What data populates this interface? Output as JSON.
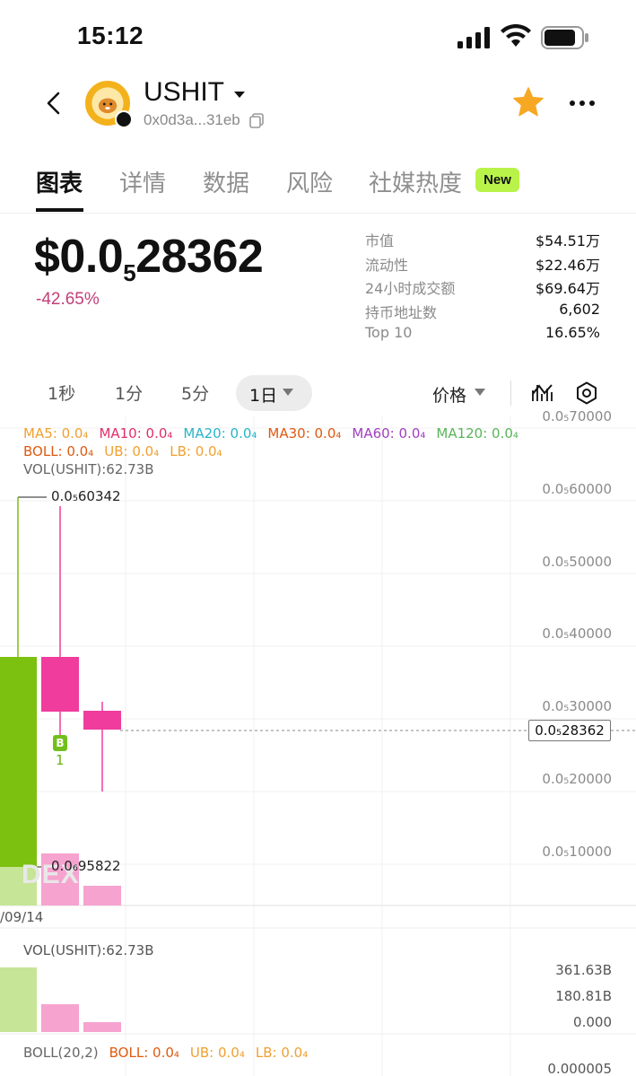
{
  "status_bar": {
    "time": "15:12"
  },
  "header": {
    "token_name": "USHIT",
    "token_address": "0x0d3a...31eb"
  },
  "tabs": [
    {
      "label": "图表",
      "active": true
    },
    {
      "label": "详情"
    },
    {
      "label": "数据"
    },
    {
      "label": "风险"
    },
    {
      "label": "社媒热度",
      "badge": "New"
    }
  ],
  "price": {
    "prefix": "$0.0",
    "zeros": "5",
    "digits": "28362",
    "change": "-42.65%"
  },
  "stats": [
    {
      "label": "市值",
      "value": "$54.51万"
    },
    {
      "label": "流动性",
      "value": "$22.46万"
    },
    {
      "label": "24小时成交额",
      "value": "$69.64万"
    },
    {
      "label": "持币地址数",
      "value": "6,602"
    },
    {
      "label": "Top 10",
      "value": "16.65%"
    }
  ],
  "intervals": [
    "1秒",
    "1分",
    "5分"
  ],
  "active_interval": "1日",
  "price_select": "价格",
  "ma_legend": [
    {
      "label": "MA5: 0.0₄",
      "color": "#f0a030"
    },
    {
      "label": "MA10: 0.0₄",
      "color": "#e0306a"
    },
    {
      "label": "MA20: 0.0₄",
      "color": "#28b4c8"
    },
    {
      "label": "MA30: 0.0₄",
      "color": "#e05a10"
    },
    {
      "label": "MA60: 0.0₄",
      "color": "#a040c0"
    },
    {
      "label": "MA120: 0.0₄",
      "color": "#5ab45a"
    }
  ],
  "boll_legend": [
    {
      "label": "BOLL: 0.0₄",
      "color": "#e05a10"
    },
    {
      "label": "UB: 0.0₄",
      "color": "#f0a030"
    },
    {
      "label": "LB: 0.0₄",
      "color": "#f0a030"
    }
  ],
  "vol_legend": "VOL(USHIT):62.73B",
  "chart": {
    "y_labels": [
      "0.0₅70000",
      "0.0₅60000",
      "0.0₅50000",
      "0.0₅40000",
      "0.0₅30000",
      "0.0₅20000",
      "0.0₅10000"
    ],
    "current_price": "0.0₅28362",
    "high_label": "0.0₅60342",
    "low_label": "0.0₆95822",
    "date_label": "/09/14",
    "buy_marker": "B",
    "buy_count": "1",
    "watermark": "DEX",
    "up_color": "#7cc010",
    "down_color": "#f03c9c"
  },
  "chart_data": {
    "type": "candlestick",
    "ylim": [
      1e-07,
      7e-07
    ],
    "candles": [
      {
        "open": 9.5822e-07,
        "high": 6.0342e-06,
        "low": 9.5822e-07,
        "close": 3.8e-06,
        "color": "up",
        "volume": 361.63
      },
      {
        "open": 3.8e-06,
        "high": 5.9e-06,
        "low": 2.5e-06,
        "close": 3e-06,
        "color": "down",
        "volume": 110
      },
      {
        "open": 2.7e-06,
        "high": 3.2e-06,
        "low": 1.6e-06,
        "close": 2.8362e-06,
        "color": "down",
        "volume": 40
      }
    ]
  },
  "vol_axis": [
    "361.63B",
    "180.81B",
    "0.000"
  ],
  "boll_title": "BOLL(20,2)",
  "boll_axis": "0.000005"
}
